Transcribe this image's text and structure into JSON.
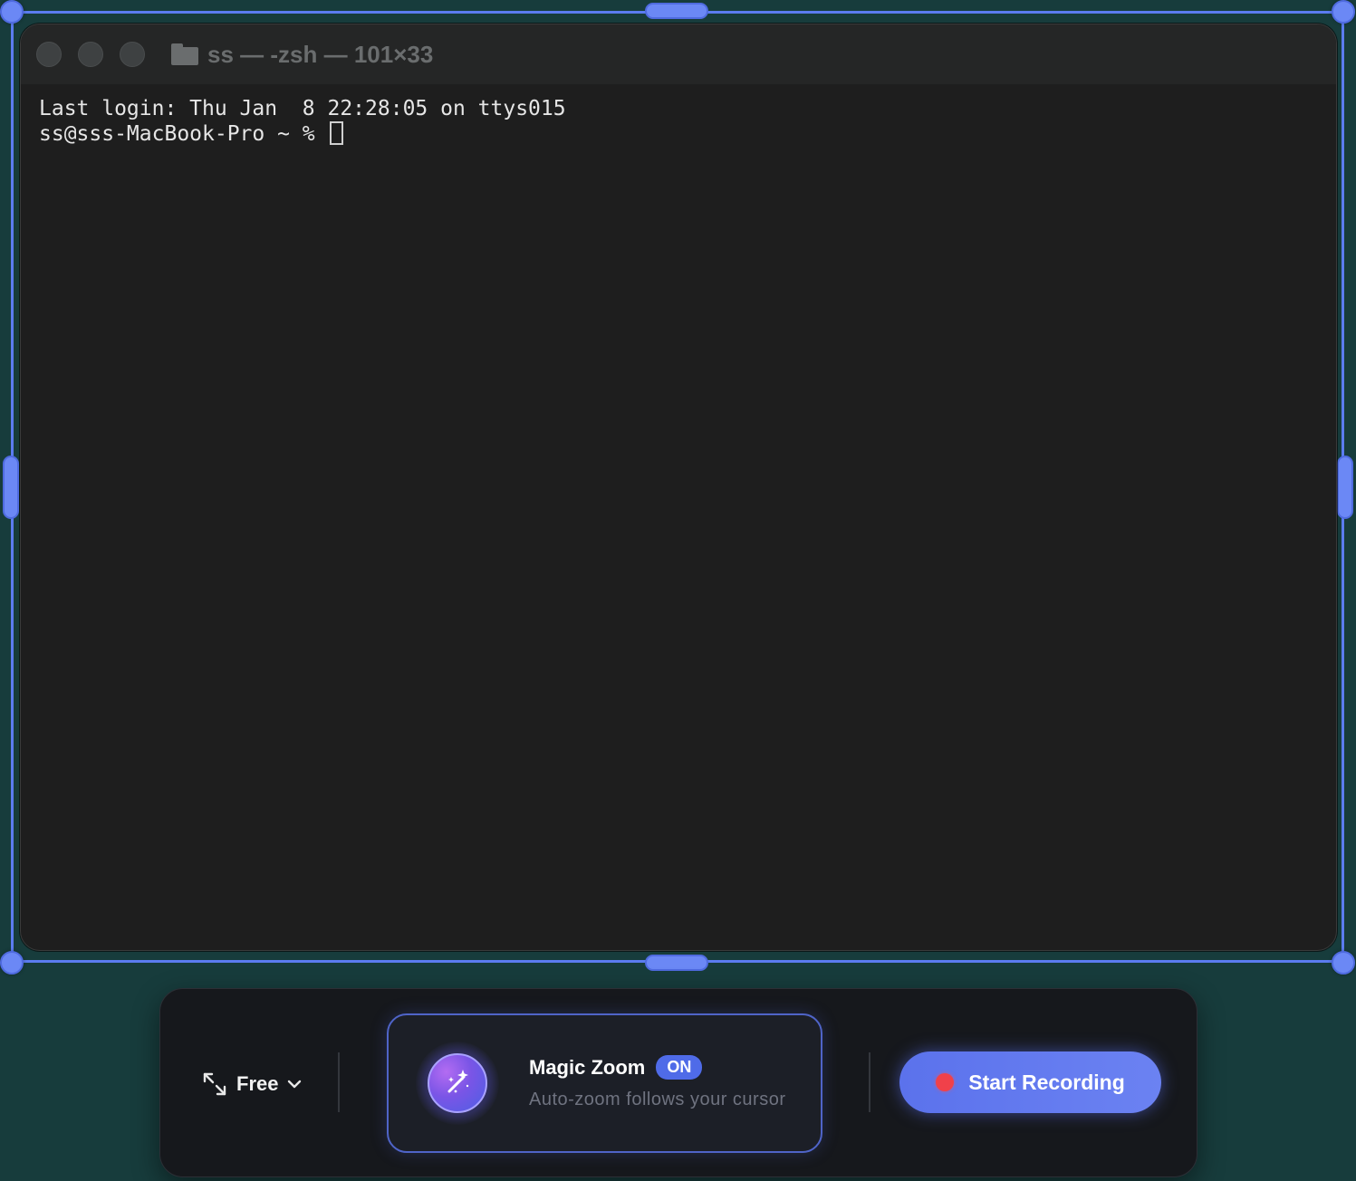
{
  "terminal": {
    "title": "ss — -zsh — 101×33",
    "lines": [
      "Last login: Thu Jan  8 22:28:05 on ttys015",
      "ss@sss-MacBook-Pro ~ % "
    ]
  },
  "toolbar": {
    "aspect_label": "Free",
    "magic_zoom": {
      "title": "Magic Zoom",
      "badge": "ON",
      "subtitle": "Auto-zoom follows your cursor"
    },
    "record_label": "Start Recording"
  },
  "colors": {
    "background": "#173c3c",
    "selection": "#5b7cf0",
    "accent": "#5b72ec",
    "record_dot": "#f0414a"
  },
  "icons": {
    "aspect": "resize-diagonal-icon",
    "magic_zoom": "magic-wand-icon",
    "record": "record-dot-icon"
  }
}
